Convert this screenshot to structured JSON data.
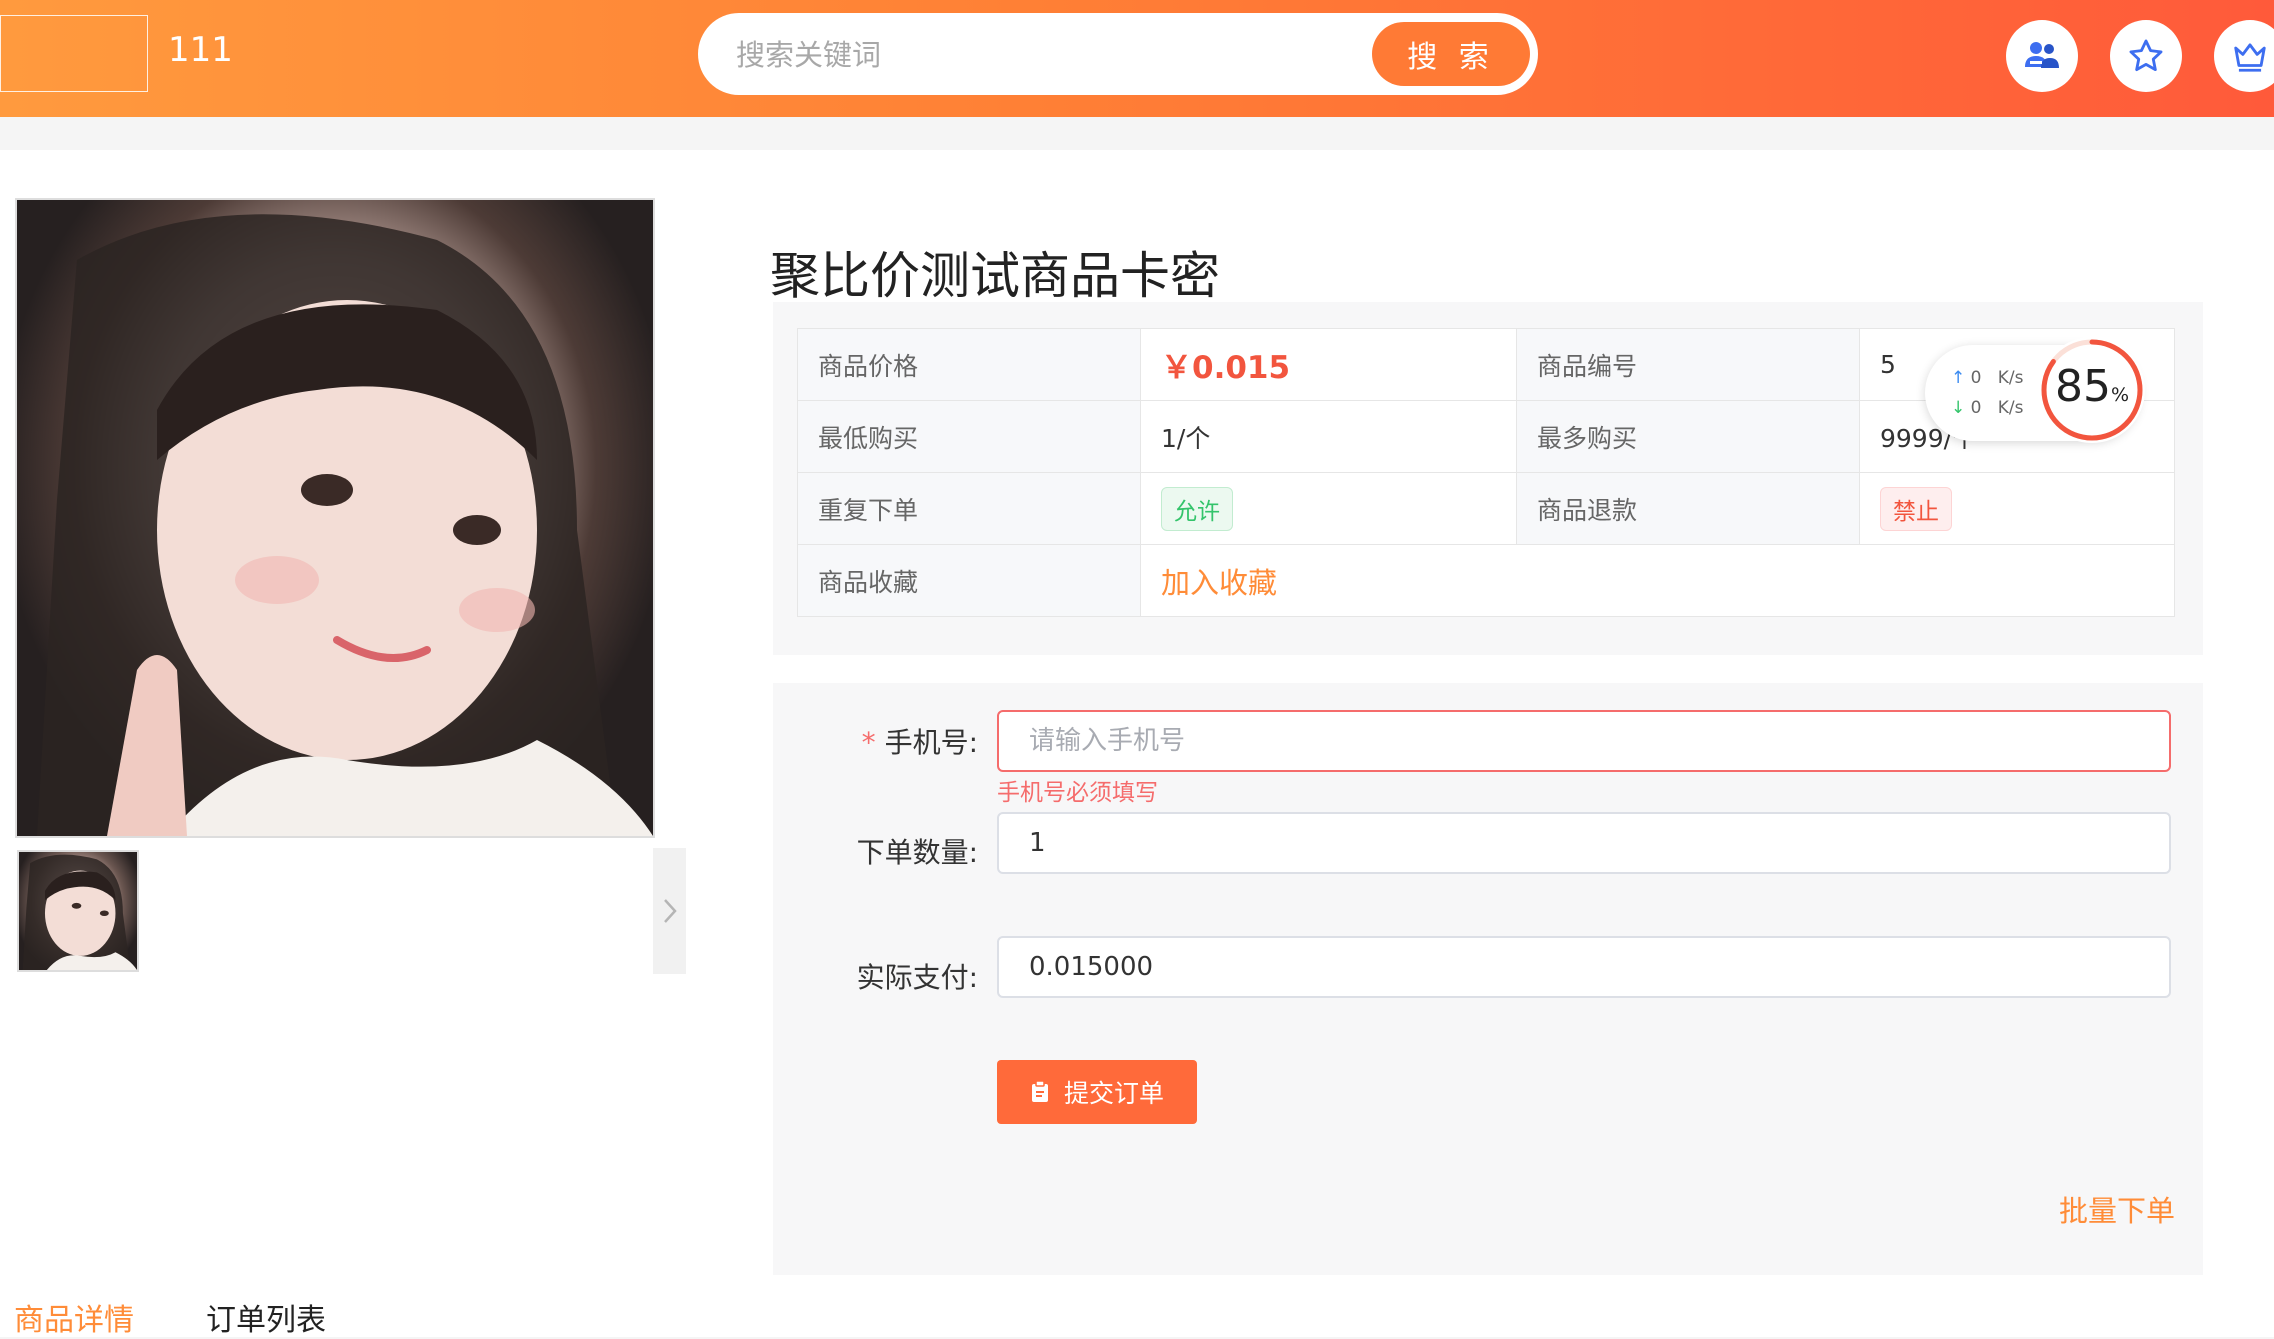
{
  "header": {
    "site_name": "111",
    "search_placeholder": "搜索关键词",
    "search_button": "搜 索",
    "icons": [
      "user-group-icon",
      "star-icon",
      "crown-icon"
    ],
    "brand_color": "#ff7a35"
  },
  "product": {
    "title": "聚比价测试商品卡密",
    "info": {
      "price_label": "商品价格",
      "price_value": "￥0.015",
      "code_label": "商品编号",
      "code_value": "5",
      "min_label": "最低购买",
      "min_value": "1/个",
      "max_label": "最多购买",
      "max_value": "9999/个",
      "repeat_label": "重复下单",
      "repeat_value": "允许",
      "refund_label": "商品退款",
      "refund_value": "禁止",
      "fav_label": "商品收藏",
      "fav_value": "加入收藏"
    }
  },
  "speed_widget": {
    "up": "0",
    "down": "0",
    "unit": "K/s",
    "percent": "85",
    "percent_sign": "%"
  },
  "order_form": {
    "phone_required_mark": "*",
    "phone_label": "手机号:",
    "phone_placeholder": "请输入手机号",
    "phone_error": "手机号必须填写",
    "qty_label": "下单数量:",
    "qty_value": "1",
    "pay_label": "实际支付:",
    "pay_value": "0.015000",
    "submit": "提交订单",
    "batch": "批量下单"
  },
  "tabs": [
    {
      "label": "商品详情",
      "active": true
    },
    {
      "label": "订单列表",
      "active": false
    }
  ]
}
